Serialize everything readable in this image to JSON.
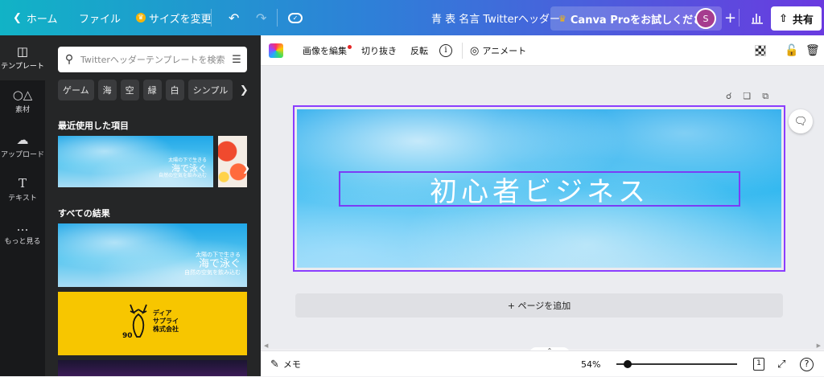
{
  "topbar": {
    "home_label": "ホーム",
    "file_label": "ファイル",
    "resize_label": "サイズを変更",
    "doc_title": "青 表 名言 Twitterヘッダー",
    "pro_label": "Canva Proをお試しください",
    "avatar_initial": "S",
    "share_label": "共有"
  },
  "rail": {
    "items": [
      {
        "label": "テンプレート"
      },
      {
        "label": "素材"
      },
      {
        "label": "アップロード"
      },
      {
        "label": "テキスト"
      },
      {
        "label": "もっと見る"
      }
    ]
  },
  "panel": {
    "search_placeholder": "Twitterヘッダーテンプレートを検索",
    "chips": [
      "ゲーム",
      "海",
      "空",
      "緑",
      "白",
      "シンプル"
    ],
    "recent_title": "最近使用した項目",
    "all_results_title": "すべての結果",
    "template_sky": {
      "line1": "太陽の下で生きる",
      "line2": "海で泳ぐ",
      "line3": "自然の空気を飲み込む"
    },
    "template_deer": {
      "line1": "ディア",
      "line2": "サプライ",
      "line3": "株式会社",
      "number": "90"
    }
  },
  "toolbar": {
    "edit_image_label": "画像を編集",
    "crop_label": "切り抜き",
    "flip_label": "反転",
    "animate_label": "アニメート"
  },
  "canvas": {
    "main_text": "初心者ビジネス",
    "add_page_label": "+ ページを追加"
  },
  "bottombar": {
    "notes_label": "メモ",
    "zoom_label": "54%",
    "zoom_level": 0.09,
    "page_count": "1"
  },
  "colors": {
    "accent": "#8b3dff",
    "topbar_start": "#11b3c6",
    "topbar_end": "#6a3ae0",
    "panel_bg": "#252627",
    "rail_bg": "#18191b"
  }
}
